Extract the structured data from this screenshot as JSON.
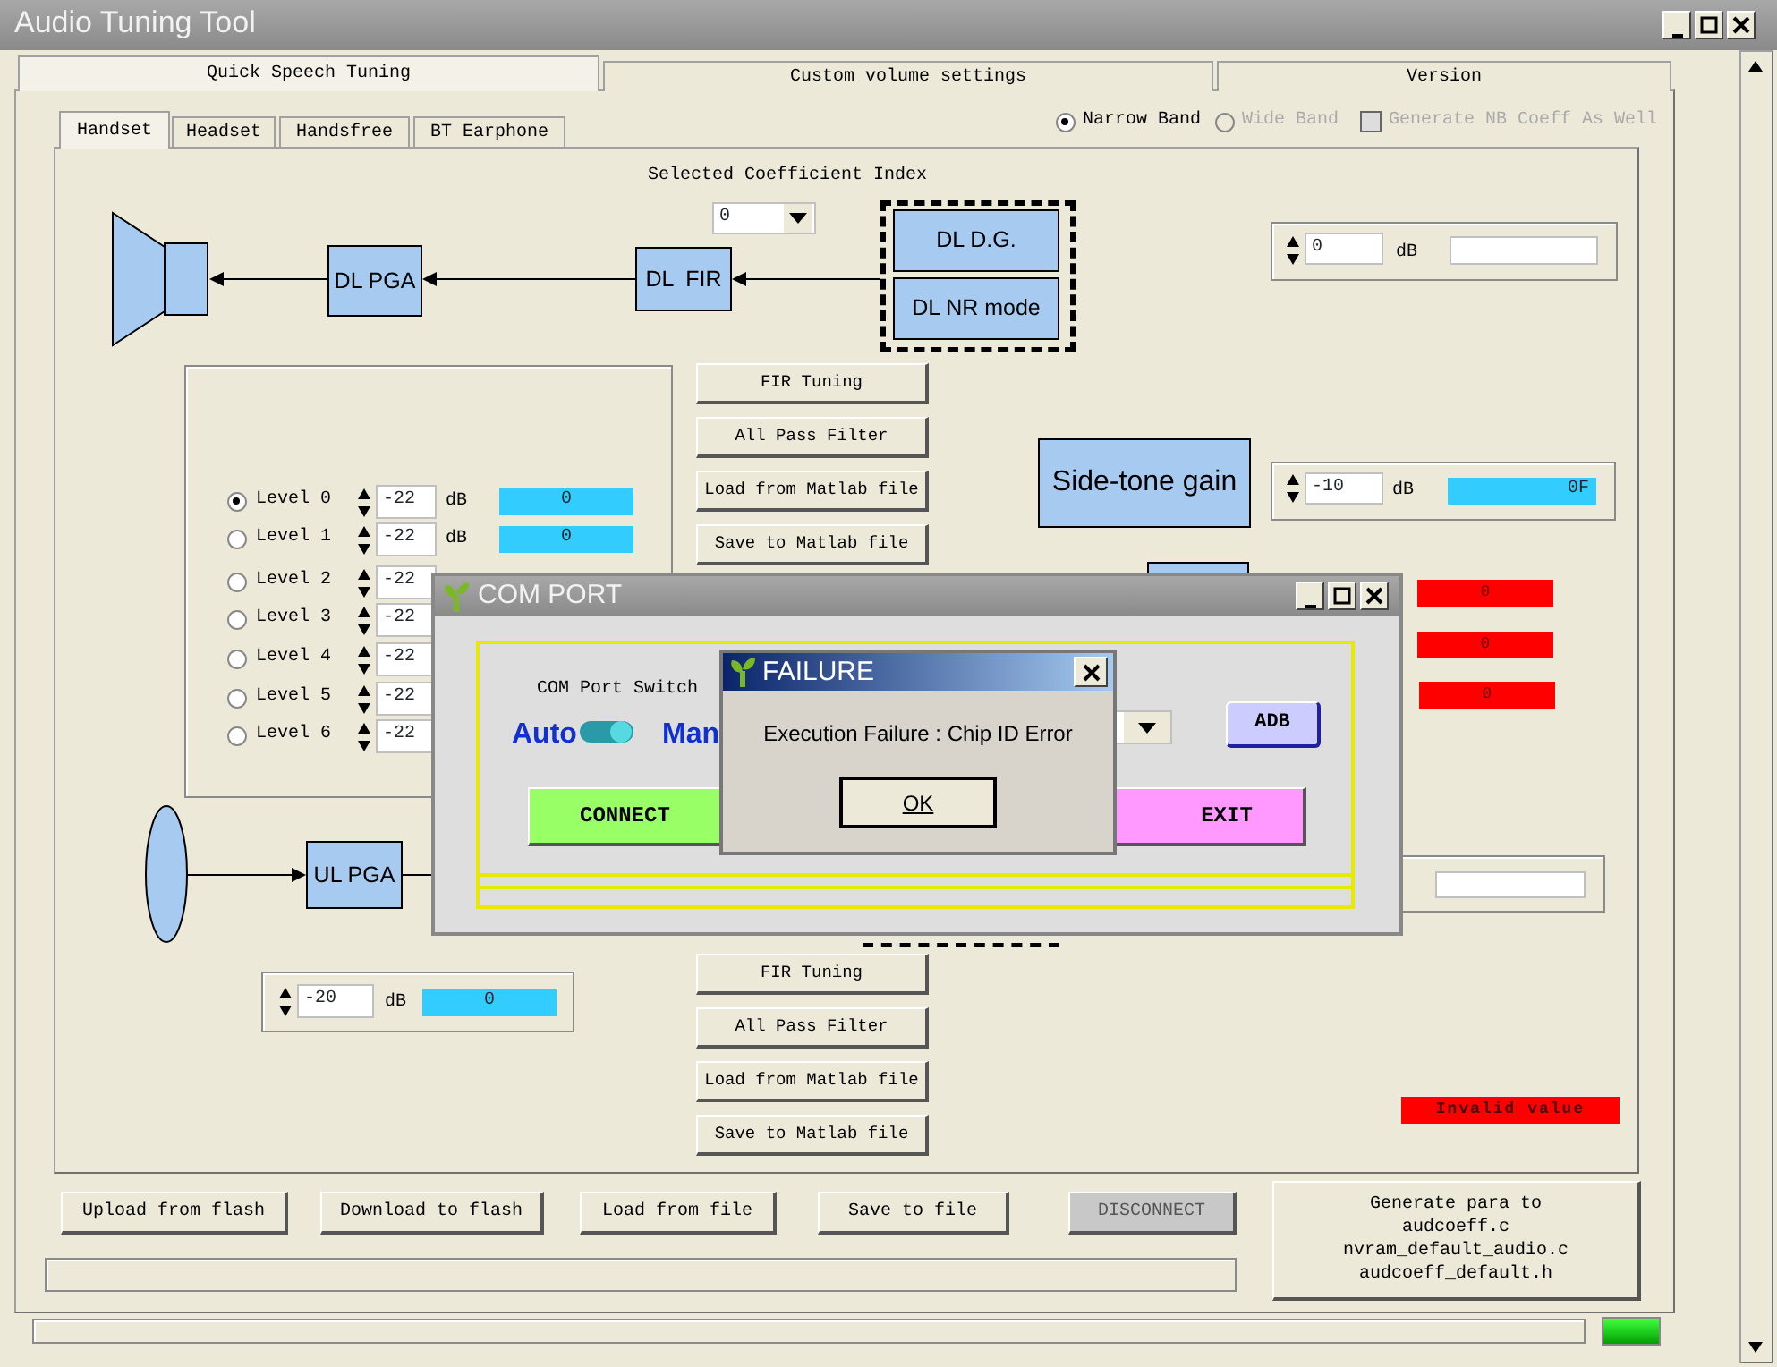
{
  "window": {
    "title": "Audio Tuning Tool"
  },
  "main_tabs": [
    {
      "label": "Quick Speech Tuning",
      "selected": true
    },
    {
      "label": "Custom volume settings",
      "selected": false
    },
    {
      "label": "Version",
      "selected": false
    }
  ],
  "mode_tabs": [
    {
      "label": "Handset",
      "selected": true
    },
    {
      "label": "Headset",
      "selected": false
    },
    {
      "label": "Handsfree",
      "selected": false
    },
    {
      "label": "BT Earphone",
      "selected": false
    }
  ],
  "band": [
    {
      "label": "Narrow Band",
      "selected": true,
      "disabled": false
    },
    {
      "label": "Wide Band",
      "selected": false,
      "disabled": true
    }
  ],
  "generate_nb": {
    "label": "Generate NB Coeff As Well",
    "checked": false,
    "disabled": true
  },
  "coefficient": {
    "label": "Selected Coefficient Index",
    "value": "0"
  },
  "downlink": {
    "pga": "DL PGA",
    "fir": "DL  FIR",
    "dg": "DL D.G.",
    "nr": "DL NR mode",
    "gain": {
      "value": "0",
      "unit": "dB"
    },
    "buttons": [
      "FIR Tuning",
      "All Pass Filter",
      "Load from Matlab file",
      "Save to Matlab file"
    ]
  },
  "levels": [
    {
      "label": "Level 0",
      "selected": true,
      "value": "-22",
      "unit": "dB",
      "reading": "0"
    },
    {
      "label": "Level 1",
      "selected": false,
      "value": "-22",
      "unit": "dB",
      "reading": "0"
    },
    {
      "label": "Level 2",
      "selected": false,
      "value": "-22"
    },
    {
      "label": "Level 3",
      "selected": false,
      "value": "-22"
    },
    {
      "label": "Level 4",
      "selected": false,
      "value": "-22"
    },
    {
      "label": "Level 5",
      "selected": false,
      "value": "-22"
    },
    {
      "label": "Level 6",
      "selected": false,
      "value": "-22"
    }
  ],
  "side_tone": {
    "label": "Side-tone gain",
    "value": "-10",
    "unit": "dB",
    "reading": "0F"
  },
  "red_readings": [
    "0",
    "0",
    "0"
  ],
  "uplink": {
    "pga": "UL PGA",
    "gain": {
      "value": "-20",
      "unit": "dB",
      "reading": "0"
    },
    "buttons": [
      "FIR Tuning",
      "All Pass Filter",
      "Load from Matlab file",
      "Save to Matlab file"
    ]
  },
  "warning": "Invalid value",
  "bottom_buttons": [
    {
      "label": "Upload from flash",
      "disabled": false
    },
    {
      "label": "Download to flash",
      "disabled": false
    },
    {
      "label": "Load from file",
      "disabled": false
    },
    {
      "label": "Save to file",
      "disabled": false
    },
    {
      "label": "DISCONNECT",
      "disabled": true
    }
  ],
  "generate_button": [
    "Generate para to",
    "audcoeff.c",
    "nvram_default_audio.c",
    "audcoeff_default.h"
  ],
  "progress": {
    "level": 0
  },
  "com_port": {
    "title": "COM PORT",
    "switch_label": "COM Port Switch",
    "switch_on": true,
    "auto": "Auto",
    "manual": "Man",
    "connect": "CONNECT",
    "adb": "ADB",
    "exit": "EXIT"
  },
  "failure": {
    "title": "FAILURE",
    "message": "Execution Failure : Chip ID Error",
    "ok": "OK"
  }
}
